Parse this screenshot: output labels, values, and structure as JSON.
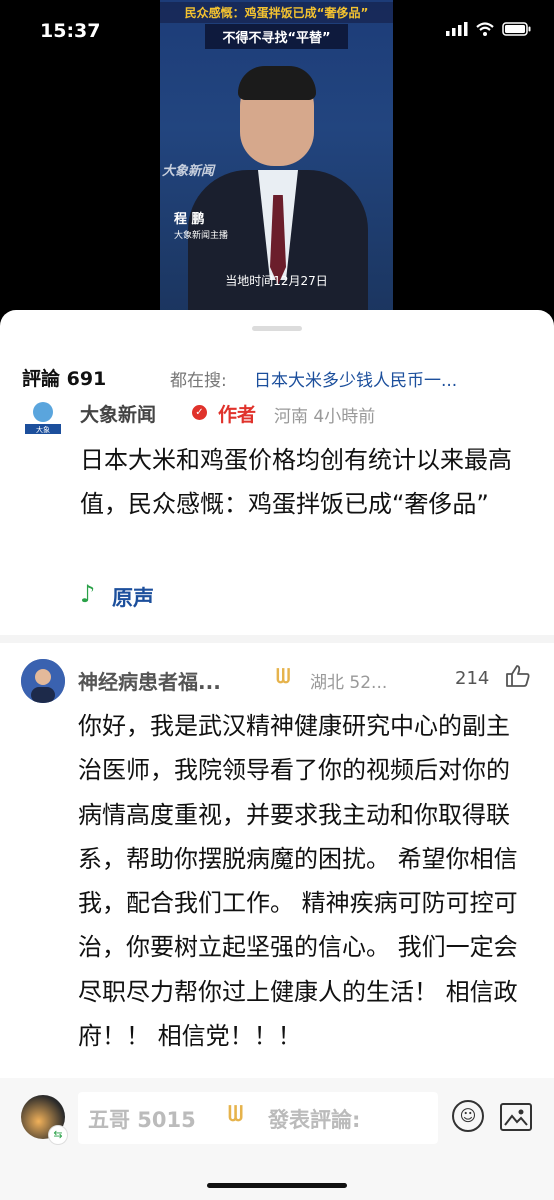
{
  "status_bar": {
    "time": "15:37",
    "icons": [
      "signal-icon",
      "wifi-icon",
      "battery-icon"
    ]
  },
  "video": {
    "headline": "民众感慨：鸡蛋拌饭已成“奢侈品”",
    "subheadline": "不得不寻找“平替”",
    "watermark": "大象新闻",
    "anchor_name": "程 鹏",
    "anchor_title": "大象新闻主播",
    "caption": "当地时间12月27日"
  },
  "header": {
    "comments_label": "評論 691",
    "search_prefix": "都在搜:",
    "search_link": "日本大米多少钱人民币一..."
  },
  "post": {
    "author": "大象新闻",
    "author_tag": "作者",
    "meta": "河南 4小時前",
    "text": "日本大米和鸡蛋价格均创有统计以来最高值，民众感慨：鸡蛋拌饭已成“奢侈品”",
    "sound_label": "原声"
  },
  "comment": {
    "user": "神经病患者福...",
    "region": "湖北 52...",
    "likes": "214",
    "text": "你好，我是武汉精神健康研究中心的副主治医师，我院领导看了你的视频后对你的病情高度重视，并要求我主动和你取得联系，帮助你摆脱病魔的困扰。 希望你相信我，配合我们工作。 精神疾病可防可控可治，你要树立起坚强的信心。 我们一定会尽职尽力帮你过上健康人的生活！ 相信政府！！ 相信党！！！"
  },
  "composer": {
    "user": "五哥 5015",
    "placeholder": "發表評論:"
  },
  "colors": {
    "link": "#1c4f9c",
    "author_tag": "#e0322b",
    "vip": "#e6b34c",
    "sound": "#2aa148"
  }
}
